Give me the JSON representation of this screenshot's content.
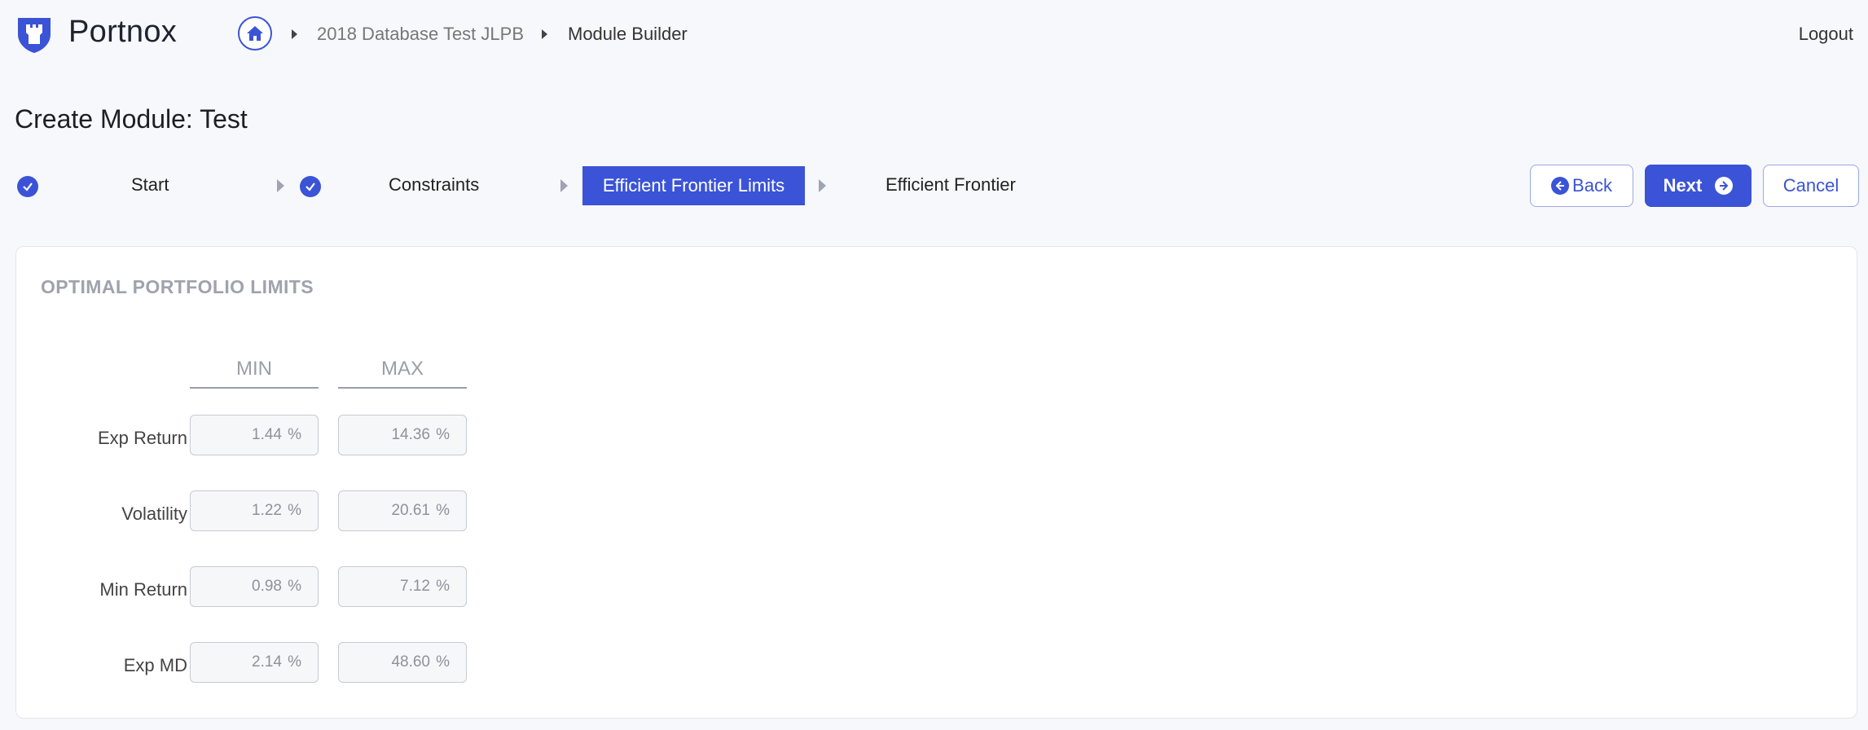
{
  "app": {
    "name": "Portnox"
  },
  "breadcrumb": {
    "items": [
      "2018 Database Test JLPB",
      "Module Builder"
    ]
  },
  "header": {
    "logout_label": "Logout"
  },
  "page": {
    "title": "Create Module: Test"
  },
  "steps": [
    {
      "label": "Start",
      "status": "complete"
    },
    {
      "label": "Constraints",
      "status": "complete"
    },
    {
      "label": "Efficient Frontier Limits",
      "status": "active"
    },
    {
      "label": "Efficient Frontier",
      "status": "pending"
    }
  ],
  "actions": {
    "back_label": "Back",
    "next_label": "Next",
    "cancel_label": "Cancel"
  },
  "limits": {
    "section_title": "OPTIMAL PORTFOLIO LIMITS",
    "min_header": "MIN",
    "max_header": "MAX",
    "unit": "%",
    "rows": [
      {
        "label": "Exp Return",
        "min": "1.44",
        "max": "14.36"
      },
      {
        "label": "Volatility",
        "min": "1.22",
        "max": "20.61"
      },
      {
        "label": "Min Return",
        "min": "0.98",
        "max": "7.12"
      },
      {
        "label": "Exp MD",
        "min": "2.14",
        "max": "48.60"
      }
    ]
  },
  "colors": {
    "accent": "#3b53d6",
    "muted_text": "#9fa3ad",
    "background": "#f7f8fb"
  },
  "icons": {
    "logo": "shield-tower-icon",
    "home": "home-icon",
    "check": "check-icon",
    "back": "arrow-left-circle-icon",
    "next": "arrow-right-circle-icon"
  }
}
